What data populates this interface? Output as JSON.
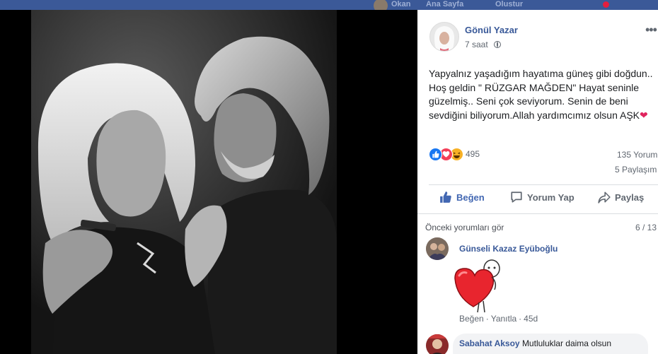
{
  "topbar": {
    "items": [
      "Okan",
      "Ana Sayfa",
      "Olustur"
    ]
  },
  "post": {
    "author": "Gönül Yazar",
    "time": "7 saat",
    "text_lines": [
      "Yapyalnız yaşadığım hayatıma güneş gibi doğdun..",
      "Hoş geldin \" RÜZGAR MAĞDEN\" Hayat seninle",
      "güzelmiş.. Seni çok seviyorum. Senin de beni",
      "sevdiğini biliyorum.Allah yardımcımız olsun AŞK"
    ],
    "text_emoji": "❤",
    "reactions_count": "495",
    "comments_count": "135 Yorum",
    "shares_count": "5 Paylaşım",
    "actions": {
      "like": "Beğen",
      "comment": "Yorum Yap",
      "share": "Paylaş"
    }
  },
  "comments": {
    "previous_label": "Önceki yorumları gör",
    "paging": "6 / 13",
    "items": [
      {
        "name": "Günseli Kazaz Eyüboğlu",
        "text": "",
        "like_label": "Beğen",
        "reply_label": "Yanıtla",
        "time": "45d"
      },
      {
        "name": "Sabahat Aksoy",
        "text": "Mutluluklar daima olsun"
      }
    ]
  },
  "colors": {
    "facebook_blue": "#3b5998",
    "link_blue": "#385898",
    "like_blue": "#4267b2",
    "love_red": "#f33e58",
    "haha_yellow": "#f7b125"
  },
  "icons": {
    "more": "more-horizontal-icon",
    "globe": "globe-icon",
    "like": "thumbs-up-icon",
    "comment": "comment-bubble-icon",
    "share": "share-arrow-icon"
  }
}
